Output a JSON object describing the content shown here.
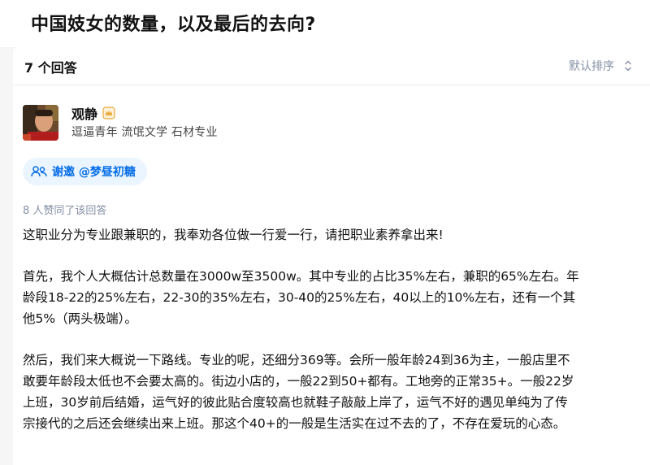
{
  "question": {
    "title": "中国妓女的数量，以及最后的去向?"
  },
  "answers_header": {
    "count_label": "7 个回答",
    "sort_label": "默认排序",
    "sort_icon": "chevron-up-down-icon"
  },
  "author": {
    "name": "观静",
    "badge_icon": "crown-badge-icon",
    "headline": "逗逼青年 流氓文学 石材专业"
  },
  "thanks_button": {
    "icon": "invite-people-icon",
    "label": "谢邀 @梦昼初糖"
  },
  "voted_text": "8 人赞同了该回答",
  "content": {
    "p1": "这职业分为专业跟兼职的，我奉劝各位做一行爱一行，请把职业素养拿出来!",
    "p2_line1": "首先，我个人大概估计总数量在3000w至3500w。其中专业的占比35%左右，兼职的65%左右。年",
    "p2_line2": "龄段18-22的25%左右，22-30的35%左右，30-40的25%左右，40以上的10%左右，还有一个其",
    "p2_line3": "他5%（两头极端）。",
    "p3_line1": "然后，我们来大概说一下路线。专业的呢，还细分369等。会所一般年龄24到36为主，一般店里不",
    "p3_line2": "敢要年龄段太低也不会要太高的。街边小店的，一般22到50+都有。工地旁的正常35+。一般22岁",
    "p3_line3": "上班，30岁前后结婚，运气好的彼此贴合度较高也就鞋子敲敲上岸了，运气不好的遇见单纯为了传",
    "p3_line4": "宗接代的之后还会继续出来上班。那这个40+的一般是生活实在过不去的了，不存在爱玩的心态。"
  },
  "colors": {
    "link_blue": "#056de8",
    "thanks_bg": "#ebf5ff",
    "muted": "#8590a6",
    "badge_gold": "#e8a93a"
  }
}
